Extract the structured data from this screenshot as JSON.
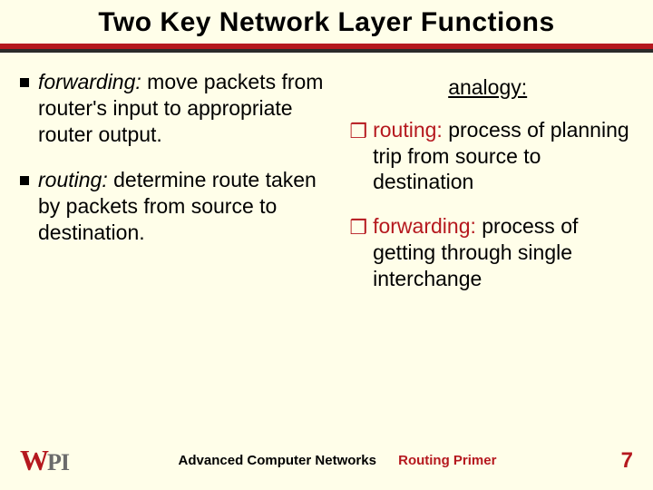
{
  "title": "Two Key Network Layer Functions",
  "left": {
    "items": [
      {
        "term": "forwarding:",
        "body": " move packets from router's input to appropriate router output."
      },
      {
        "term": "routing:",
        "body": " determine route taken by packets from source to destination."
      }
    ]
  },
  "right": {
    "heading": "analogy:",
    "items": [
      {
        "term": "routing:",
        "body": " process of planning trip from source to destination"
      },
      {
        "term": "forwarding:",
        "body": " process of getting through single interchange"
      }
    ]
  },
  "footer": {
    "logo_main": "W",
    "logo_sub": "PI",
    "course": "Advanced Computer Networks",
    "topic": "Routing Primer",
    "page": "7"
  }
}
